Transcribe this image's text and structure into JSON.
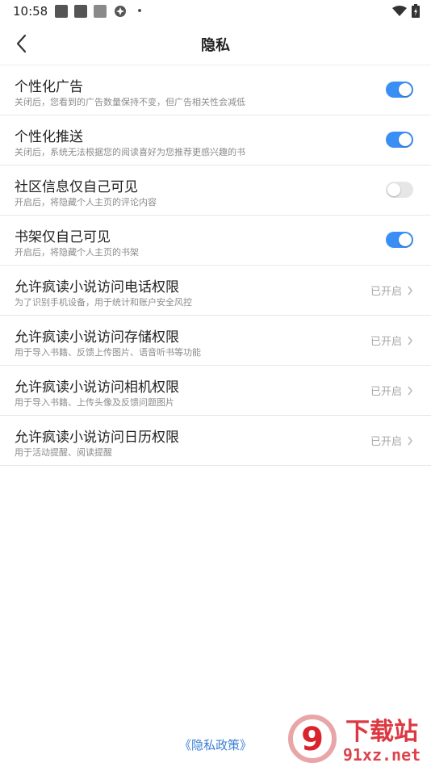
{
  "status_bar": {
    "time": "10:58",
    "icons": [
      "app-icon",
      "app-icon",
      "app-icon",
      "vpn-icon",
      "notification-dot",
      "wifi-icon",
      "battery-icon"
    ]
  },
  "header": {
    "title": "隐私",
    "back_icon": "chevron-left-icon"
  },
  "settings": [
    {
      "title": "个性化广告",
      "desc": "关闭后，您看到的广告数量保持不变，但广告相关性会减低",
      "control": "toggle",
      "on": true
    },
    {
      "title": "个性化推送",
      "desc": "关闭后，系统无法根据您的阅读喜好为您推荐更感兴趣的书",
      "control": "toggle",
      "on": true
    },
    {
      "title": "社区信息仅自己可见",
      "desc": "开启后，将隐藏个人主页的评论内容",
      "control": "toggle",
      "on": false
    },
    {
      "title": "书架仅自己可见",
      "desc": "开启后，将隐藏个人主页的书架",
      "control": "toggle",
      "on": true
    },
    {
      "title": "允许疯读小说访问电话权限",
      "desc": "为了识别手机设备，用于统计和账户安全风控",
      "control": "link",
      "status": "已开启"
    },
    {
      "title": "允许疯读小说访问存储权限",
      "desc": "用于导入书籍、反馈上传图片、语音听书等功能",
      "control": "link",
      "status": "已开启"
    },
    {
      "title": "允许疯读小说访问相机权限",
      "desc": "用于导入书籍、上传头像及反馈问题图片",
      "control": "link",
      "status": "已开启"
    },
    {
      "title": "允许疯读小说访问日历权限",
      "desc": "用于活动提醒、阅读提醒",
      "control": "link",
      "status": "已开启"
    }
  ],
  "footer": {
    "policy_link": "《隐私政策》"
  },
  "watermark": {
    "text": "下载站",
    "site": "91xz.net",
    "badge": "9"
  },
  "colors": {
    "toggle_on": "#3a8ff5",
    "toggle_off": "#e6e6e6",
    "link": "#3a7fd5",
    "watermark_red": "#d9232d"
  }
}
